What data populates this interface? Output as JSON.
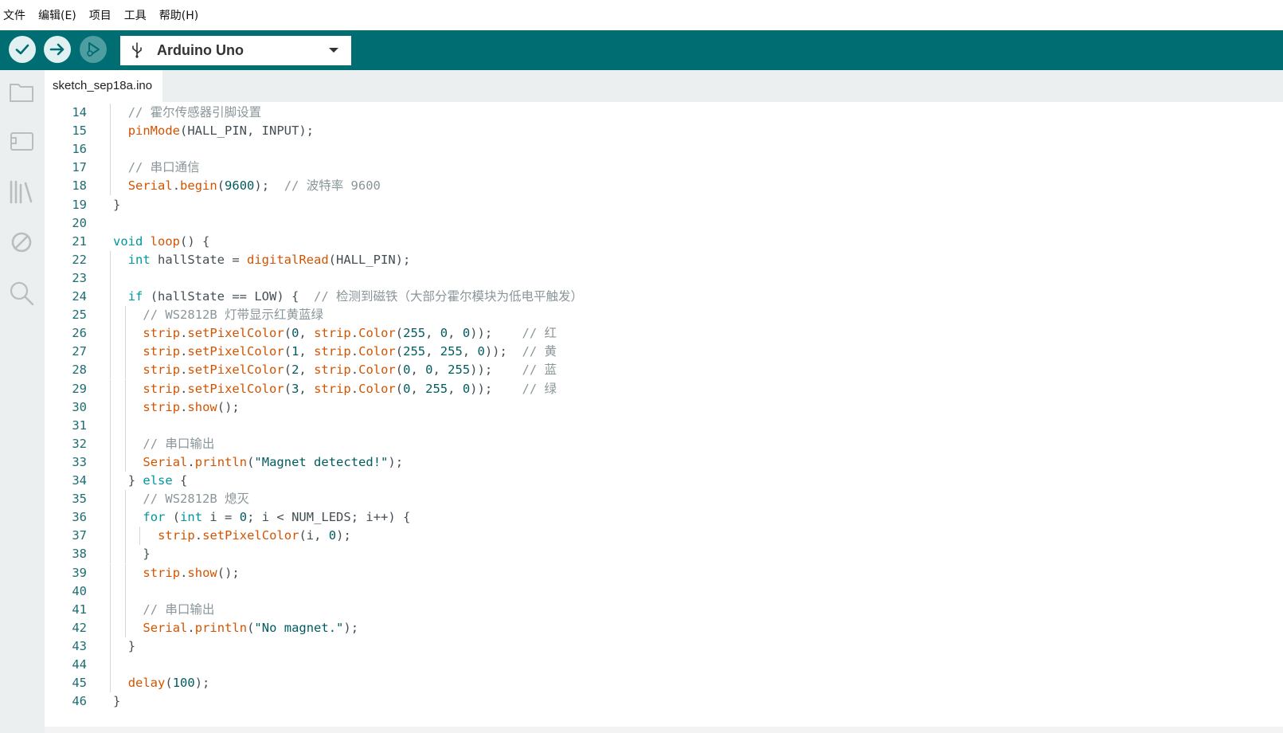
{
  "menubar": {
    "items": [
      "文件",
      "编辑(E)",
      "项目",
      "工具",
      "帮助(H)"
    ]
  },
  "toolbar": {
    "verify_icon": "check-icon",
    "upload_icon": "arrow-right-icon",
    "debug_icon": "debug-icon",
    "board_icon": "usb-icon",
    "board_name": "Arduino Uno"
  },
  "sidebar": {
    "icons": [
      "folder-icon",
      "board-manager-icon",
      "library-icon",
      "debug-disabled-icon",
      "search-icon"
    ]
  },
  "tabs": [
    {
      "label": "sketch_sep18a.ino"
    }
  ],
  "colors": {
    "toolbar_bg": "#006d72",
    "sidebar_bg": "#eceff0",
    "comment": "#8a9699",
    "function": "#d35400",
    "keyword": "#00979d",
    "literal": "#005c5f",
    "line_number": "#1e6d72"
  },
  "editor": {
    "lines": [
      {
        "n": "14",
        "indent": 1,
        "tokens": [
          [
            "cm",
            "// 霍尔传感器引脚设置"
          ]
        ]
      },
      {
        "n": "15",
        "indent": 1,
        "tokens": [
          [
            "fn",
            "pinMode"
          ],
          [
            "pl",
            "(HALL_PIN, INPUT);"
          ]
        ]
      },
      {
        "n": "16",
        "indent": 1,
        "tokens": []
      },
      {
        "n": "17",
        "indent": 1,
        "tokens": [
          [
            "cm",
            "// 串口通信"
          ]
        ]
      },
      {
        "n": "18",
        "indent": 1,
        "tokens": [
          [
            "fn",
            "Serial"
          ],
          [
            "pl",
            "."
          ],
          [
            "fn",
            "begin"
          ],
          [
            "pl",
            "("
          ],
          [
            "num",
            "9600"
          ],
          [
            "pl",
            ");  "
          ],
          [
            "cm",
            "// 波特率 9600"
          ]
        ]
      },
      {
        "n": "19",
        "indent": 0,
        "tokens": [
          [
            "pl",
            "}"
          ]
        ]
      },
      {
        "n": "20",
        "indent": 0,
        "tokens": []
      },
      {
        "n": "21",
        "indent": 0,
        "tokens": [
          [
            "kw",
            "void"
          ],
          [
            "pl",
            " "
          ],
          [
            "fn",
            "loop"
          ],
          [
            "pl",
            "() {"
          ]
        ]
      },
      {
        "n": "22",
        "indent": 1,
        "tokens": [
          [
            "kw",
            "int"
          ],
          [
            "pl",
            " hallState = "
          ],
          [
            "fn",
            "digitalRead"
          ],
          [
            "pl",
            "(HALL_PIN);"
          ]
        ]
      },
      {
        "n": "23",
        "indent": 1,
        "tokens": []
      },
      {
        "n": "24",
        "indent": 1,
        "tokens": [
          [
            "kw",
            "if"
          ],
          [
            "pl",
            " (hallState == LOW) {  "
          ],
          [
            "cm",
            "// 检测到磁铁（大部分霍尔模块为低电平触发）"
          ]
        ]
      },
      {
        "n": "25",
        "indent": 2,
        "tokens": [
          [
            "cm",
            "// WS2812B 灯带显示红黄蓝绿"
          ]
        ]
      },
      {
        "n": "26",
        "indent": 2,
        "tokens": [
          [
            "fn",
            "strip"
          ],
          [
            "pl",
            "."
          ],
          [
            "fn",
            "setPixelColor"
          ],
          [
            "pl",
            "("
          ],
          [
            "num",
            "0"
          ],
          [
            "pl",
            ", "
          ],
          [
            "fn",
            "strip"
          ],
          [
            "pl",
            "."
          ],
          [
            "fn",
            "Color"
          ],
          [
            "pl",
            "("
          ],
          [
            "num",
            "255"
          ],
          [
            "pl",
            ", "
          ],
          [
            "num",
            "0"
          ],
          [
            "pl",
            ", "
          ],
          [
            "num",
            "0"
          ],
          [
            "pl",
            "));    "
          ],
          [
            "cm",
            "// 红"
          ]
        ]
      },
      {
        "n": "27",
        "indent": 2,
        "tokens": [
          [
            "fn",
            "strip"
          ],
          [
            "pl",
            "."
          ],
          [
            "fn",
            "setPixelColor"
          ],
          [
            "pl",
            "("
          ],
          [
            "num",
            "1"
          ],
          [
            "pl",
            ", "
          ],
          [
            "fn",
            "strip"
          ],
          [
            "pl",
            "."
          ],
          [
            "fn",
            "Color"
          ],
          [
            "pl",
            "("
          ],
          [
            "num",
            "255"
          ],
          [
            "pl",
            ", "
          ],
          [
            "num",
            "255"
          ],
          [
            "pl",
            ", "
          ],
          [
            "num",
            "0"
          ],
          [
            "pl",
            "));  "
          ],
          [
            "cm",
            "// 黄"
          ]
        ]
      },
      {
        "n": "28",
        "indent": 2,
        "tokens": [
          [
            "fn",
            "strip"
          ],
          [
            "pl",
            "."
          ],
          [
            "fn",
            "setPixelColor"
          ],
          [
            "pl",
            "("
          ],
          [
            "num",
            "2"
          ],
          [
            "pl",
            ", "
          ],
          [
            "fn",
            "strip"
          ],
          [
            "pl",
            "."
          ],
          [
            "fn",
            "Color"
          ],
          [
            "pl",
            "("
          ],
          [
            "num",
            "0"
          ],
          [
            "pl",
            ", "
          ],
          [
            "num",
            "0"
          ],
          [
            "pl",
            ", "
          ],
          [
            "num",
            "255"
          ],
          [
            "pl",
            "));    "
          ],
          [
            "cm",
            "// 蓝"
          ]
        ]
      },
      {
        "n": "29",
        "indent": 2,
        "tokens": [
          [
            "fn",
            "strip"
          ],
          [
            "pl",
            "."
          ],
          [
            "fn",
            "setPixelColor"
          ],
          [
            "pl",
            "("
          ],
          [
            "num",
            "3"
          ],
          [
            "pl",
            ", "
          ],
          [
            "fn",
            "strip"
          ],
          [
            "pl",
            "."
          ],
          [
            "fn",
            "Color"
          ],
          [
            "pl",
            "("
          ],
          [
            "num",
            "0"
          ],
          [
            "pl",
            ", "
          ],
          [
            "num",
            "255"
          ],
          [
            "pl",
            ", "
          ],
          [
            "num",
            "0"
          ],
          [
            "pl",
            "));    "
          ],
          [
            "cm",
            "// 绿"
          ]
        ]
      },
      {
        "n": "30",
        "indent": 2,
        "tokens": [
          [
            "fn",
            "strip"
          ],
          [
            "pl",
            "."
          ],
          [
            "fn",
            "show"
          ],
          [
            "pl",
            "();"
          ]
        ]
      },
      {
        "n": "31",
        "indent": 2,
        "tokens": []
      },
      {
        "n": "32",
        "indent": 2,
        "tokens": [
          [
            "cm",
            "// 串口输出"
          ]
        ]
      },
      {
        "n": "33",
        "indent": 2,
        "tokens": [
          [
            "fn",
            "Serial"
          ],
          [
            "pl",
            "."
          ],
          [
            "fn",
            "println"
          ],
          [
            "pl",
            "("
          ],
          [
            "str",
            "\"Magnet detected!\""
          ],
          [
            "pl",
            ");"
          ]
        ]
      },
      {
        "n": "34",
        "indent": 1,
        "tokens": [
          [
            "pl",
            "} "
          ],
          [
            "kw",
            "else"
          ],
          [
            "pl",
            " {"
          ]
        ]
      },
      {
        "n": "35",
        "indent": 2,
        "tokens": [
          [
            "cm",
            "// WS2812B 熄灭"
          ]
        ]
      },
      {
        "n": "36",
        "indent": 2,
        "tokens": [
          [
            "kw",
            "for"
          ],
          [
            "pl",
            " ("
          ],
          [
            "kw",
            "int"
          ],
          [
            "pl",
            " i = "
          ],
          [
            "num",
            "0"
          ],
          [
            "pl",
            "; i < NUM_LEDS; i++) {"
          ]
        ]
      },
      {
        "n": "37",
        "indent": 3,
        "tokens": [
          [
            "fn",
            "strip"
          ],
          [
            "pl",
            "."
          ],
          [
            "fn",
            "setPixelColor"
          ],
          [
            "pl",
            "(i, "
          ],
          [
            "num",
            "0"
          ],
          [
            "pl",
            ");"
          ]
        ]
      },
      {
        "n": "38",
        "indent": 2,
        "tokens": [
          [
            "pl",
            "}"
          ]
        ]
      },
      {
        "n": "39",
        "indent": 2,
        "tokens": [
          [
            "fn",
            "strip"
          ],
          [
            "pl",
            "."
          ],
          [
            "fn",
            "show"
          ],
          [
            "pl",
            "();"
          ]
        ]
      },
      {
        "n": "40",
        "indent": 2,
        "tokens": []
      },
      {
        "n": "41",
        "indent": 2,
        "tokens": [
          [
            "cm",
            "// 串口输出"
          ]
        ]
      },
      {
        "n": "42",
        "indent": 2,
        "tokens": [
          [
            "fn",
            "Serial"
          ],
          [
            "pl",
            "."
          ],
          [
            "fn",
            "println"
          ],
          [
            "pl",
            "("
          ],
          [
            "str",
            "\"No magnet.\""
          ],
          [
            "pl",
            ");"
          ]
        ]
      },
      {
        "n": "43",
        "indent": 1,
        "tokens": [
          [
            "pl",
            "}"
          ]
        ]
      },
      {
        "n": "44",
        "indent": 1,
        "tokens": []
      },
      {
        "n": "45",
        "indent": 1,
        "tokens": [
          [
            "fn",
            "delay"
          ],
          [
            "pl",
            "("
          ],
          [
            "num",
            "100"
          ],
          [
            "pl",
            ");"
          ]
        ]
      },
      {
        "n": "46",
        "indent": 0,
        "tokens": [
          [
            "pl",
            "}"
          ]
        ]
      }
    ]
  }
}
